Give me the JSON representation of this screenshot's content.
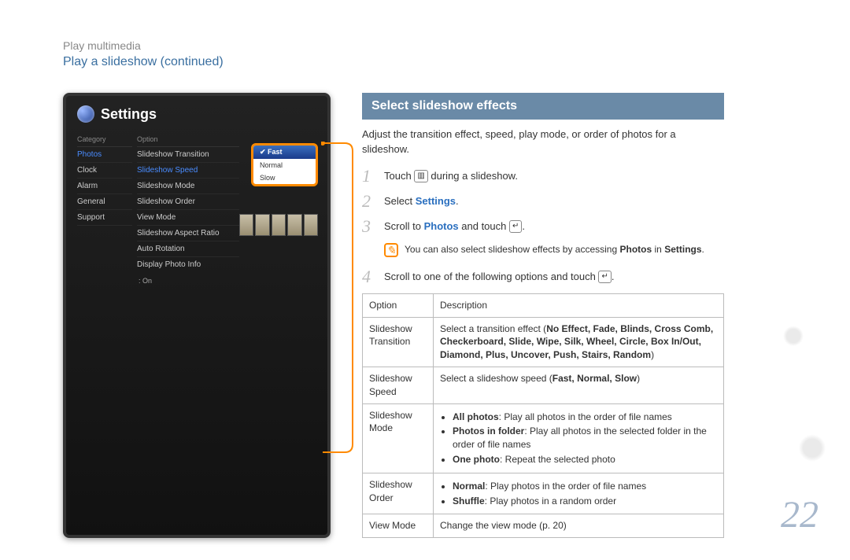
{
  "breadcrumb": "Play multimedia",
  "subtitle": "Play a slideshow  (continued)",
  "page_number": "22",
  "device": {
    "title": "Settings",
    "col_category": "Category",
    "col_option": "Option",
    "categories": [
      "Photos",
      "Clock",
      "Alarm",
      "General",
      "Support"
    ],
    "options": [
      "Slideshow Transition",
      "Slideshow Speed",
      "Slideshow Mode",
      "Slideshow Order",
      "View Mode",
      "Slideshow Aspect Ratio",
      "Auto Rotation",
      "Display Photo Info"
    ],
    "option_value_on": ": On",
    "popup": [
      "Fast",
      "Normal",
      "Slow"
    ]
  },
  "banner": "Select slideshow effects",
  "intro": "Adjust the transition effect, speed, play mode, or order of photos for a slideshow.",
  "steps": {
    "s1_a": "Touch ",
    "s1_b": " during a slideshow.",
    "s2_a": "Select ",
    "s2_b": "Settings",
    "s2_c": ".",
    "s3_a": "Scroll to ",
    "s3_b": "Photos",
    "s3_c": " and touch ",
    "s3_d": ".",
    "s4_a": "Scroll to one of the following options and touch ",
    "s4_b": "."
  },
  "note": {
    "line1_a": "You can also select slideshow effects by accessing ",
    "line1_b": "Photos",
    "line1_c": " in ",
    "line2": "Settings",
    "line2_b": "."
  },
  "table": {
    "head_option": "Option",
    "head_desc": "Description",
    "rows": {
      "transition": {
        "label": "Slideshow Transition",
        "pre": "Select a transition effect (",
        "bold": "No Effect, Fade, Blinds, Cross Comb, Checkerboard, Slide, Wipe, Silk, Wheel, Circle, Box In/Out, Diamond, Plus, Uncover, Push, Stairs, Random",
        "post": ")"
      },
      "speed": {
        "label": "Slideshow Speed",
        "pre": "Select a slideshow speed (",
        "bold": "Fast, Normal, Slow",
        "post": ")"
      },
      "mode": {
        "label": "Slideshow Mode",
        "b1": "All photos",
        "t1": ": Play all photos in the order of file names",
        "b2": "Photos in folder",
        "t2": ": Play all photos in the selected folder in the order of file names",
        "b3": "One photo",
        "t3": ": Repeat the selected photo"
      },
      "order": {
        "label": "Slideshow Order",
        "b1": "Normal",
        "t1": ": Play photos in the order of file names",
        "b2": "Shuffle",
        "t2": ": Play photos in a random order"
      },
      "view": {
        "label": "View Mode",
        "text": "Change the view mode (p. 20)"
      }
    }
  },
  "icons": {
    "menu": "▥",
    "enter": "↵"
  }
}
